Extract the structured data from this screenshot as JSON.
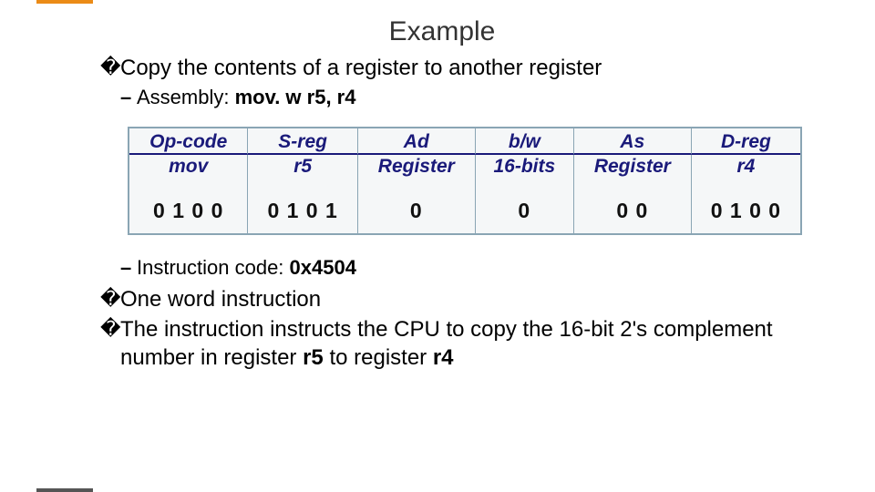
{
  "title": "Example",
  "bullets": {
    "b1": "Copy the contents of a register to another register",
    "b1a_prefix": "Assembly: ",
    "b1a_code": "mov. w r5, r4",
    "b1b_prefix": "Instruction code: ",
    "b1b_code": "0x4504",
    "b2": "One word instruction",
    "b3_part1": "The instruction instructs the CPU to copy the 16-bit 2's complement number in register ",
    "b3_r1": "r5",
    "b3_mid": " to register ",
    "b3_r2": "r4"
  },
  "table": {
    "headers": [
      "Op-code",
      "S-reg",
      "Ad",
      "b/w",
      "As",
      "D-reg"
    ],
    "subs": [
      "mov",
      "r5",
      "Register",
      "16-bits",
      "Register",
      "r4"
    ],
    "values": [
      "0 1 0 0",
      "0 1 0 1",
      "0",
      "0",
      "0 0",
      "0 1 0 0"
    ]
  },
  "glyph": "�"
}
